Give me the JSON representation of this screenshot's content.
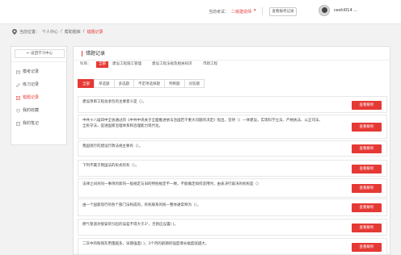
{
  "header": {
    "exam_label": "当前考试：",
    "exam_value": "二级建造师",
    "caret": "▾",
    "history_button": "查看报考记录",
    "username": "ceshi014 ..."
  },
  "breadcrumb": {
    "prefix": "当前位置：",
    "items": [
      "个人中心",
      "/",
      "帮助题库",
      "/",
      "错题记录"
    ]
  },
  "sidebar": {
    "back_label": "返回学习中心",
    "items": [
      {
        "label": "模考记录"
      },
      {
        "label": "练习记录"
      },
      {
        "label": "错题记录"
      },
      {
        "label": "我的收藏"
      },
      {
        "label": "我的笔记"
      }
    ],
    "active_index": 2
  },
  "main": {
    "title": "错题记录",
    "filter_label": "科目：",
    "filters": [
      "全部",
      "建设工程施工管理",
      "建设工程法规及相关知识",
      "市政工程"
    ],
    "type_tabs": [
      "全部",
      "单选题",
      "多选题",
      "不定项选择题",
      "判断题",
      "问答题"
    ]
  },
  "questions": [
    {
      "text": "建设项目工程总承包的主要意义是（）。",
      "button": "查看解析"
    },
    {
      "text": "中共十八届四中全会通过的《中共中央关于全面推进依法治国若干重大问题的决定》指出，坚持（）一体建设，实现科学立法、严格执法、公正司法、全民守法，促进国家治理体系和治理能力现代化。",
      "button": "查看解析"
    },
    {
      "text": "我国现行的建设行政法规主要有（）。",
      "button": "查看解析"
    },
    {
      "text": "下列不属于我国法的形式的有（）。",
      "button": "查看解析"
    },
    {
      "text": "法律之间对同一事项的新的一般规定与旧的特别规定不一致，不能确定如何适用时，由表决行裁决的机构是（）",
      "button": "查看解析"
    },
    {
      "text": "由一个国家现行的各个部门法构成的，有机联系的统一整体通常称为（）。",
      "button": "查看解析"
    },
    {
      "text": "燃气管道对接安装引起的误差不得大于3°，否则应设置( )。",
      "button": "查看解析"
    },
    {
      "text": "二灰中的粉煤灰用量越多，早期强度( )，3个月的龄期的强度增长幅度就越大。",
      "button": "查看解析"
    }
  ],
  "colors": {
    "accent": "#e53935"
  }
}
